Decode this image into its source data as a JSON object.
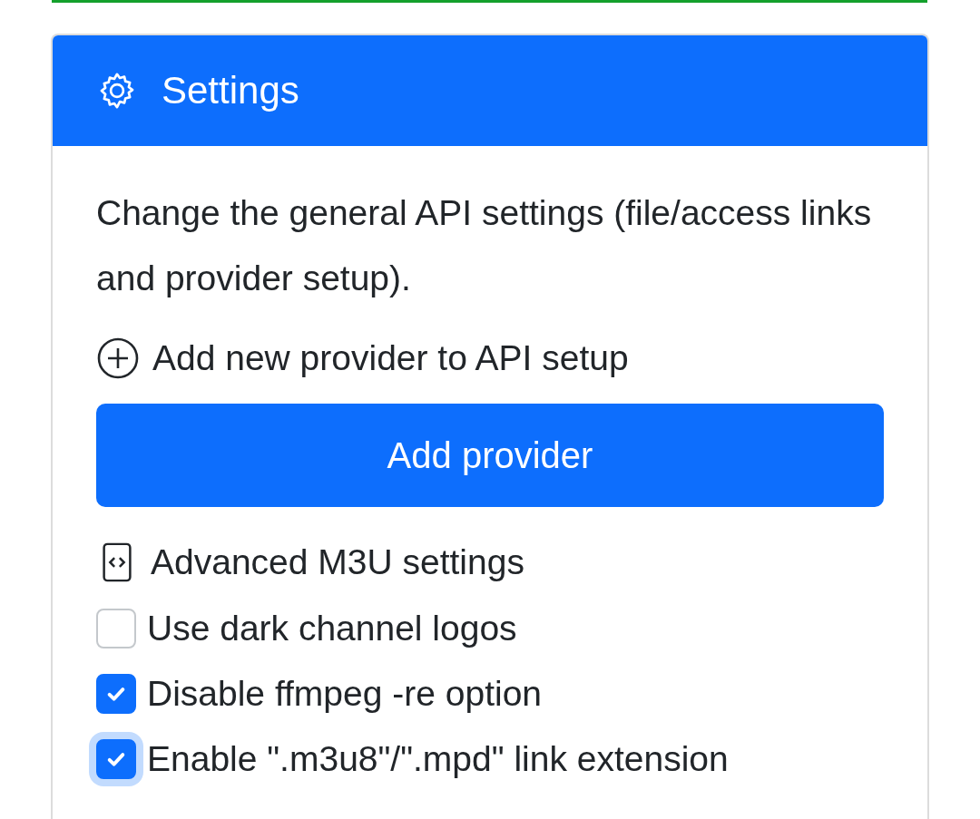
{
  "header": {
    "title": "Settings"
  },
  "description": "Change the general API settings (file/access links and provider setup).",
  "add_provider": {
    "label": "Add new provider to API setup",
    "button": "Add provider"
  },
  "advanced": {
    "label": "Advanced M3U settings"
  },
  "options": [
    {
      "label": "Use dark channel logos",
      "checked": false,
      "focused": false
    },
    {
      "label": "Disable ffmpeg -re option",
      "checked": true,
      "focused": false
    },
    {
      "label": "Enable \".m3u8\"/\".mpd\" link extension",
      "checked": true,
      "focused": true
    }
  ]
}
